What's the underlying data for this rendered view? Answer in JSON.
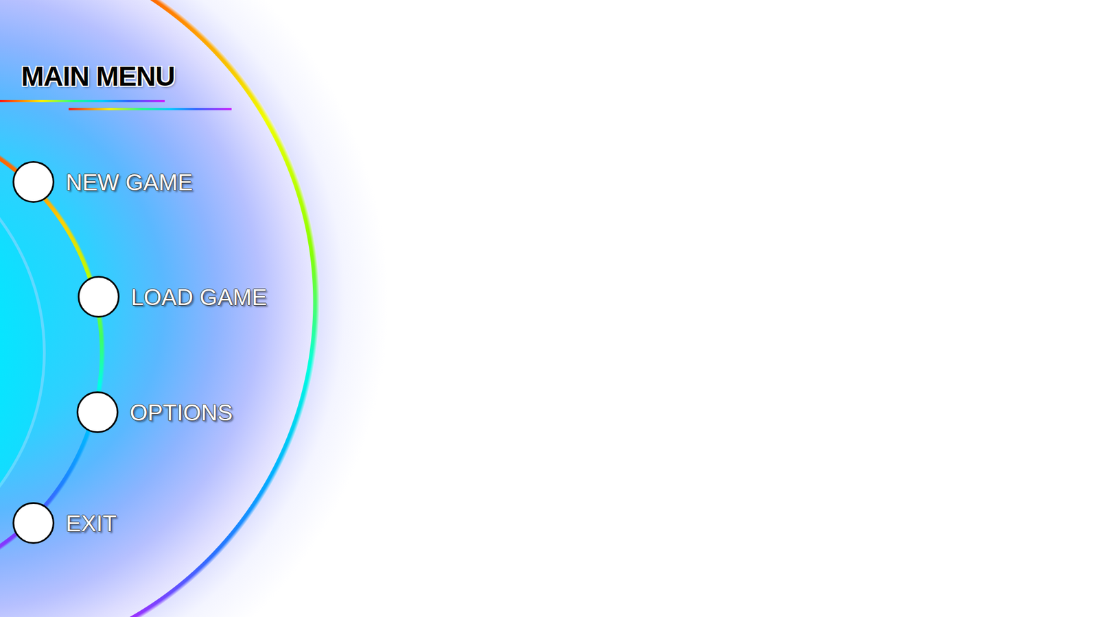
{
  "title": "MAIN MENU",
  "menu": {
    "items": [
      {
        "label": "NEW GAME"
      },
      {
        "label": "LOAD GAME"
      },
      {
        "label": "OPTIONS"
      },
      {
        "label": "EXIT"
      }
    ]
  }
}
